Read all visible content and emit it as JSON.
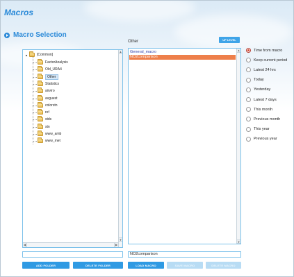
{
  "window": {
    "title": "Macros"
  },
  "section": {
    "title": "Macro Selection"
  },
  "current_folder": "Other",
  "up_level_label": "UP LEVEL",
  "tree": {
    "root": "[Common]",
    "items": [
      {
        "label": "FactorAnalysis",
        "selected": false
      },
      {
        "label": "Old_URA4",
        "selected": false
      },
      {
        "label": "Other",
        "selected": true
      },
      {
        "label": "Statistics",
        "selected": false
      },
      {
        "label": "airviro",
        "selected": false
      },
      {
        "label": "avguest",
        "selected": false
      },
      {
        "label": "colorstn",
        "selected": false
      },
      {
        "label": "ref",
        "selected": false
      },
      {
        "label": "stds",
        "selected": false
      },
      {
        "label": "stn",
        "selected": false
      },
      {
        "label": "www_amb",
        "selected": false
      },
      {
        "label": "www_met",
        "selected": false
      }
    ]
  },
  "macros": {
    "items": [
      {
        "label": "General_macro",
        "selected": false
      },
      {
        "label": "NO2comparison",
        "selected": true
      }
    ]
  },
  "period_options": {
    "items": [
      {
        "label": "Time from macro",
        "checked": true
      },
      {
        "label": "Keep current period",
        "checked": false
      },
      {
        "label": "Latest 24 hrs",
        "checked": false
      },
      {
        "label": "Today",
        "checked": false
      },
      {
        "label": "Yesterday",
        "checked": false
      },
      {
        "label": "Latest 7 days",
        "checked": false
      },
      {
        "label": "This month",
        "checked": false
      },
      {
        "label": "Previous month",
        "checked": false
      },
      {
        "label": "This year",
        "checked": false
      },
      {
        "label": "Previous year",
        "checked": false
      }
    ]
  },
  "folder_input": {
    "value": ""
  },
  "macro_input": {
    "value": "NO2comparison"
  },
  "buttons": {
    "add_folder": "ADD FOLDER",
    "delete_folder": "DELETE FOLDER",
    "load_macro": "LOAD MACRO",
    "save_macro": "SAVE MACRO",
    "delete_macro": "DELETE MACRO"
  },
  "colors": {
    "accent": "#2b8ad8",
    "button": "#2f9ae3",
    "button_disabled": "#b8dcf4",
    "selection": "#ee7f4a",
    "panel_border": "#7cc1ea"
  }
}
